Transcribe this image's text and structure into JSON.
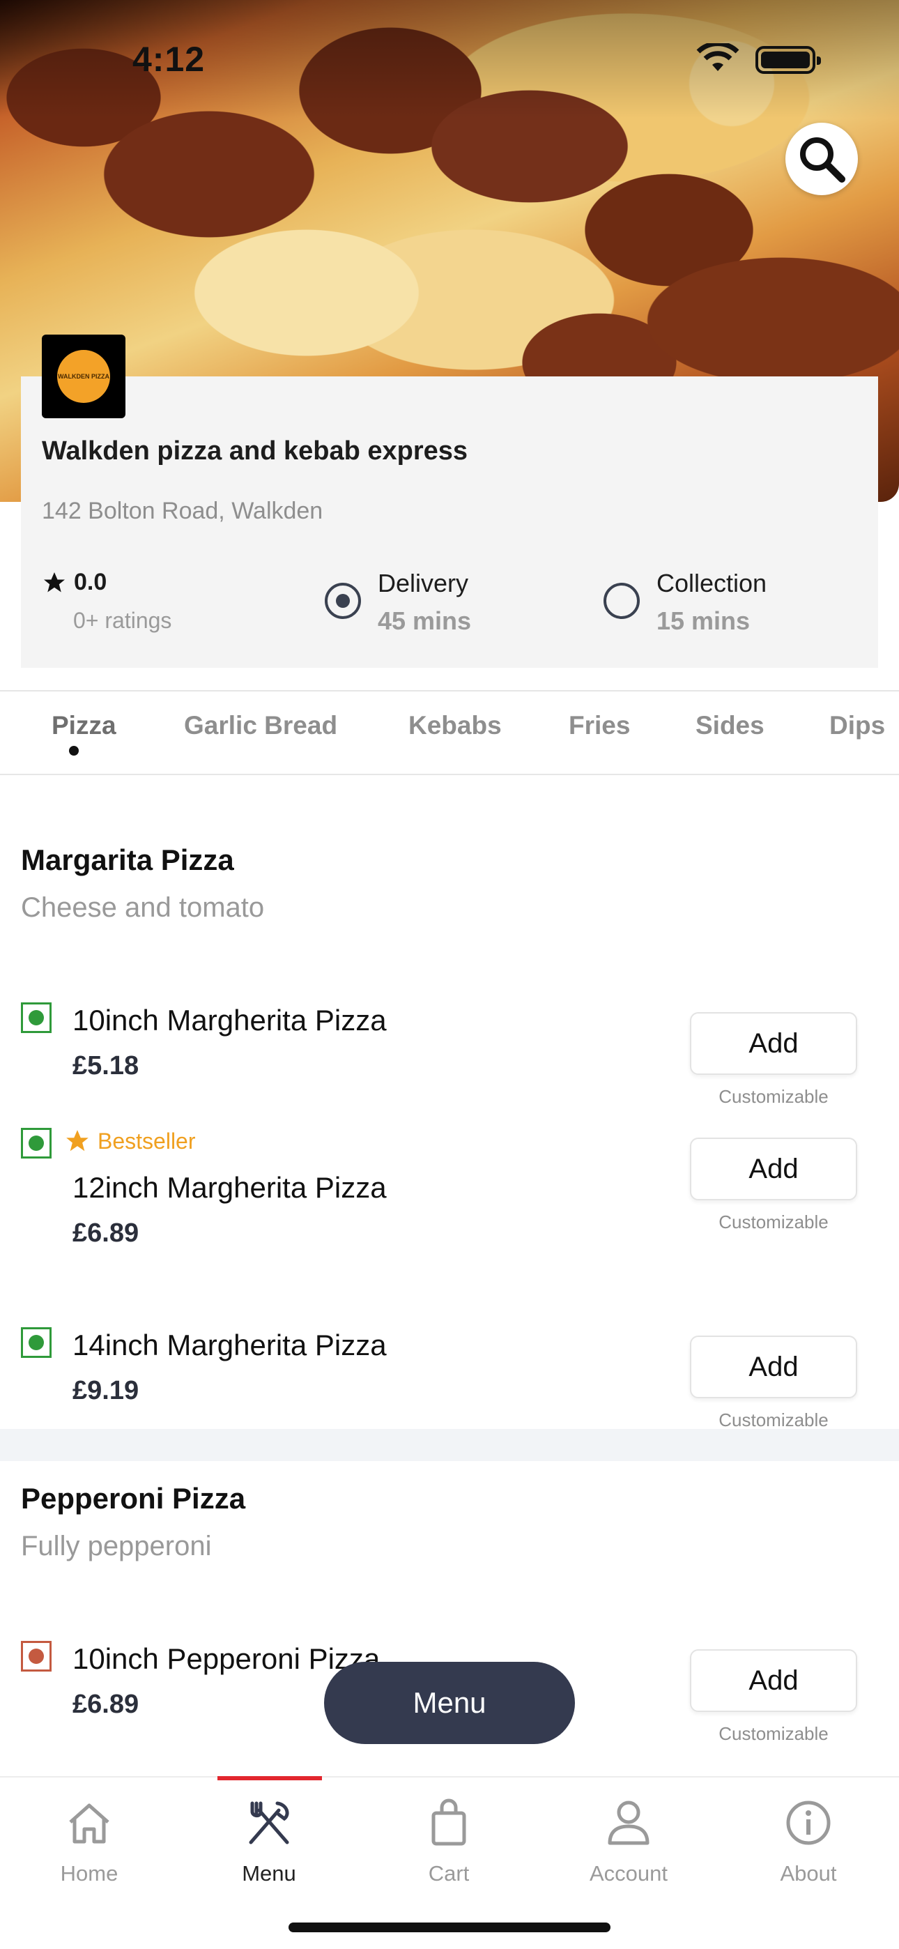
{
  "status_bar": {
    "time": "4:12"
  },
  "store": {
    "name": "Walkden pizza and kebab express",
    "address": "142 Bolton Road, Walkden",
    "logo_text": "WALKDEN PIZZA",
    "rating": "0.0",
    "rating_count": "0+ ratings",
    "delivery": {
      "label": "Delivery",
      "time": "45 mins",
      "selected": true
    },
    "collection": {
      "label": "Collection",
      "time": "15 mins",
      "selected": false
    }
  },
  "tabs": [
    {
      "label": "Pizza",
      "active": true
    },
    {
      "label": "Garlic Bread"
    },
    {
      "label": "Kebabs"
    },
    {
      "label": "Fries"
    },
    {
      "label": "Sides"
    },
    {
      "label": "Dips"
    }
  ],
  "sections": [
    {
      "title": "Margarita Pizza",
      "description": "Cheese and tomato",
      "items": [
        {
          "name": "10inch Margherita Pizza",
          "price": "£5.18",
          "add_label": "Add",
          "note": "Customizable",
          "type": "veg"
        },
        {
          "name": "12inch Margherita Pizza",
          "price": "£6.89",
          "add_label": "Add",
          "note": "Customizable",
          "type": "veg",
          "badge": "Bestseller"
        },
        {
          "name": "14inch Margherita Pizza",
          "price": "£9.19",
          "add_label": "Add",
          "note": "Customizable",
          "type": "veg"
        }
      ]
    },
    {
      "title": "Pepperoni Pizza",
      "description": "Fully pepperoni",
      "items": [
        {
          "name": "10inch Pepperoni Pizza",
          "price": "£6.89",
          "add_label": "Add",
          "note": "Customizable",
          "type": "non-veg"
        }
      ]
    }
  ],
  "floating_menu": {
    "label": "Menu"
  },
  "bottom_nav": [
    {
      "label": "Home",
      "icon": "home-icon"
    },
    {
      "label": "Menu",
      "icon": "fork-knife-icon",
      "active": true
    },
    {
      "label": "Cart",
      "icon": "shopping-bag-icon"
    },
    {
      "label": "Account",
      "icon": "user-icon"
    },
    {
      "label": "About",
      "icon": "info-icon"
    }
  ],
  "colors": {
    "accent": "#e2262e",
    "dark": "#343a4f",
    "veg": "#2f9a3a",
    "nonveg": "#c45a40",
    "bestseller": "#f0a020"
  }
}
